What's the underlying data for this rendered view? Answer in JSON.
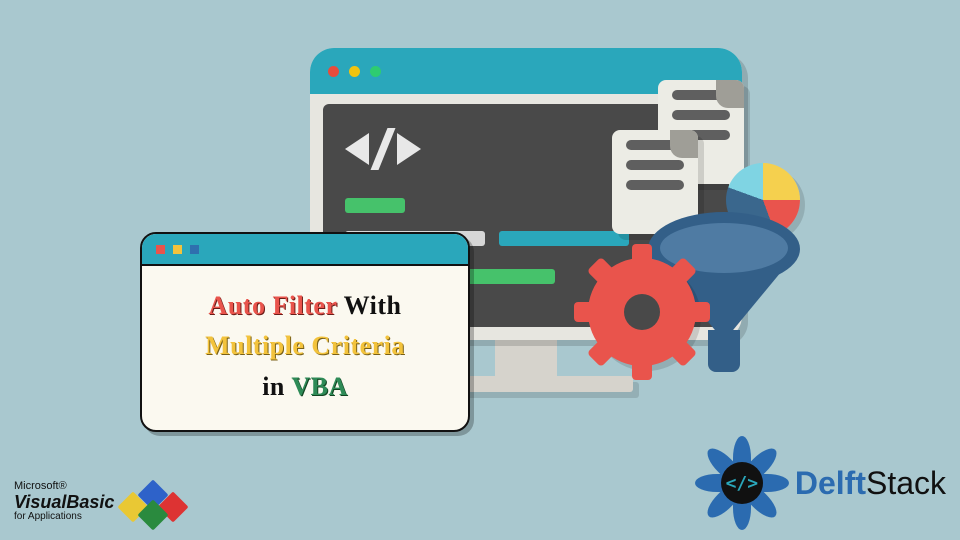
{
  "title": {
    "word1": "Auto Filter",
    "word2": "With",
    "word3": "Multiple Criteria",
    "word4": "in",
    "word5": "VBA"
  },
  "vba_logo": {
    "vendor": "Microsoft®",
    "product": "VisualBasic",
    "sub": "for Applications"
  },
  "delft": {
    "brand_blue": "Delft",
    "brand_rest": "Stack",
    "core": "</>"
  },
  "monitor": {
    "dots": [
      "red",
      "yellow",
      "green"
    ]
  }
}
